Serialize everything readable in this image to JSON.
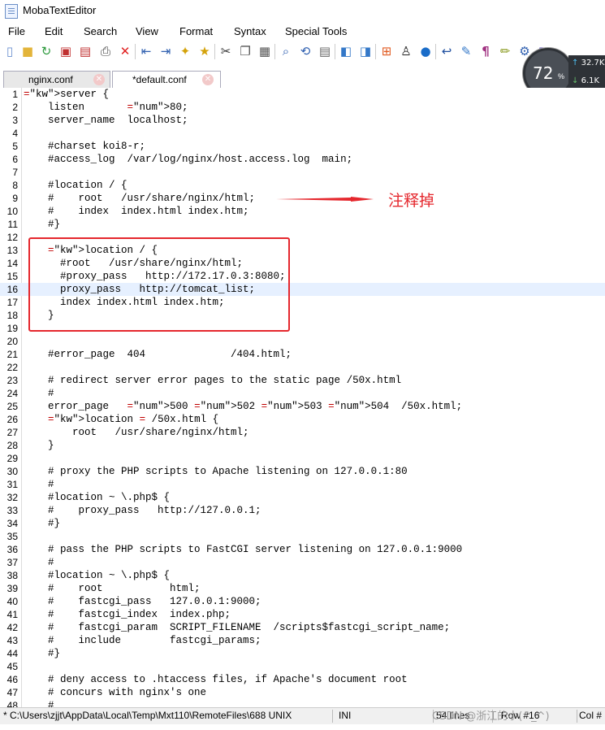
{
  "window": {
    "title": "MobaTextEditor"
  },
  "menu": [
    "File",
    "Edit",
    "Search",
    "View",
    "Format",
    "Syntax",
    "Special Tools"
  ],
  "toolbar": {
    "buttons": [
      "new-file-icon",
      "open-folder-icon",
      "reload-icon",
      "save-icon",
      "save-all-icon",
      "print-icon",
      "close-icon",
      "unindent-icon",
      "indent-icon",
      "bookmark-icon",
      "star-icon",
      "cut-icon",
      "copy-icon",
      "paste-icon",
      "find-icon",
      "find-replace-icon",
      "goto-icon",
      "window-icon",
      "window-alt-icon",
      "windows-icon",
      "linux-icon",
      "apple-icon",
      "wrap-icon",
      "edit-icon",
      "paragraph-icon",
      "pen-icon",
      "settings-icon",
      "extra-icon"
    ]
  },
  "perf": {
    "percent": "72",
    "percent_suffix": "%",
    "upload": "32.7K",
    "download": "6.1K"
  },
  "tabs": [
    {
      "label": "nginx.conf",
      "active": false
    },
    {
      "label": "*default.conf",
      "active": true
    }
  ],
  "editor": {
    "lines": [
      {
        "n": "1",
        "t": "server {"
      },
      {
        "n": "2",
        "t": "    listen       80;"
      },
      {
        "n": "3",
        "t": "    server_name  localhost;"
      },
      {
        "n": "4",
        "t": ""
      },
      {
        "n": "5",
        "t": "    #charset koi8-r;"
      },
      {
        "n": "6",
        "t": "    #access_log  /var/log/nginx/host.access.log  main;"
      },
      {
        "n": "7",
        "t": ""
      },
      {
        "n": "8",
        "t": "    #location / {"
      },
      {
        "n": "9",
        "t": "    #    root   /usr/share/nginx/html;"
      },
      {
        "n": "10",
        "t": "    #    index  index.html index.htm;"
      },
      {
        "n": "11",
        "t": "    #}"
      },
      {
        "n": "12",
        "t": ""
      },
      {
        "n": "13",
        "t": "    location / {"
      },
      {
        "n": "14",
        "t": "      #root   /usr/share/nginx/html;"
      },
      {
        "n": "15",
        "t": "      #proxy_pass   http://172.17.0.3:8080;"
      },
      {
        "n": "16",
        "t": "      proxy_pass   http://tomcat_list;"
      },
      {
        "n": "17",
        "t": "      index index.html index.htm;"
      },
      {
        "n": "18",
        "t": "    }"
      },
      {
        "n": "19",
        "t": ""
      },
      {
        "n": "20",
        "t": ""
      },
      {
        "n": "21",
        "t": "    #error_page  404              /404.html;"
      },
      {
        "n": "22",
        "t": ""
      },
      {
        "n": "23",
        "t": "    # redirect server error pages to the static page /50x.html"
      },
      {
        "n": "24",
        "t": "    #"
      },
      {
        "n": "25",
        "t": "    error_page   500 502 503 504  /50x.html;"
      },
      {
        "n": "26",
        "t": "    location = /50x.html {"
      },
      {
        "n": "27",
        "t": "        root   /usr/share/nginx/html;"
      },
      {
        "n": "28",
        "t": "    }"
      },
      {
        "n": "29",
        "t": ""
      },
      {
        "n": "30",
        "t": "    # proxy the PHP scripts to Apache listening on 127.0.0.1:80"
      },
      {
        "n": "31",
        "t": "    #"
      },
      {
        "n": "32",
        "t": "    #location ~ \\.php$ {"
      },
      {
        "n": "33",
        "t": "    #    proxy_pass   http://127.0.0.1;"
      },
      {
        "n": "34",
        "t": "    #}"
      },
      {
        "n": "35",
        "t": ""
      },
      {
        "n": "36",
        "t": "    # pass the PHP scripts to FastCGI server listening on 127.0.0.1:9000"
      },
      {
        "n": "37",
        "t": "    #"
      },
      {
        "n": "38",
        "t": "    #location ~ \\.php$ {"
      },
      {
        "n": "39",
        "t": "    #    root           html;"
      },
      {
        "n": "40",
        "t": "    #    fastcgi_pass   127.0.0.1:9000;"
      },
      {
        "n": "41",
        "t": "    #    fastcgi_index  index.php;"
      },
      {
        "n": "42",
        "t": "    #    fastcgi_param  SCRIPT_FILENAME  /scripts$fastcgi_script_name;"
      },
      {
        "n": "43",
        "t": "    #    include        fastcgi_params;"
      },
      {
        "n": "44",
        "t": "    #}"
      },
      {
        "n": "45",
        "t": ""
      },
      {
        "n": "46",
        "t": "    # deny access to .htaccess files, if Apache's document root"
      },
      {
        "n": "47",
        "t": "    # concurs with nginx's one"
      },
      {
        "n": "48",
        "t": "    #"
      }
    ]
  },
  "annotation": {
    "text": "注释掉"
  },
  "status": {
    "path": "* C:\\Users\\zjjt\\AppData\\Local\\Temp\\Mxt110\\RemoteFiles\\688 UNIX",
    "encoding": "INI",
    "lines": "54 lines",
    "position": "Row #16",
    "col": "Col #"
  },
  "watermark": "CSDN @浙江的小(^_^)"
}
